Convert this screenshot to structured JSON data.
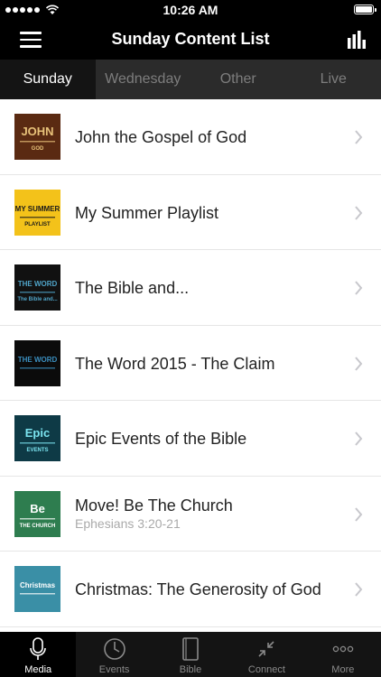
{
  "status_bar": {
    "time": "10:26 AM"
  },
  "header": {
    "title": "Sunday Content List"
  },
  "tabs": [
    {
      "label": "Sunday",
      "active": true
    },
    {
      "label": "Wednesday",
      "active": false
    },
    {
      "label": "Other",
      "active": false
    },
    {
      "label": "Live",
      "active": false
    }
  ],
  "items": [
    {
      "title": "John the Gospel of God",
      "subtitle": "",
      "thumb": {
        "bg": "#5a2a12",
        "accent": "#e8c27a",
        "lines": [
          "JOHN",
          "GOD"
        ]
      }
    },
    {
      "title": "My Summer Playlist",
      "subtitle": "",
      "thumb": {
        "bg": "#f3c21a",
        "accent": "#1a1a1a",
        "lines": [
          "MY SUMMER",
          "PLAYLIST"
        ]
      }
    },
    {
      "title": "The Bible and...",
      "subtitle": "",
      "thumb": {
        "bg": "#111111",
        "accent": "#4fa3c7",
        "lines": [
          "THE WORD",
          "The Bible and..."
        ]
      }
    },
    {
      "title": "The Word 2015 - The Claim",
      "subtitle": "",
      "thumb": {
        "bg": "#0b0b0b",
        "accent": "#3b8fbf",
        "lines": [
          "THE WORD",
          ""
        ]
      }
    },
    {
      "title": "Epic Events of the Bible",
      "subtitle": "",
      "thumb": {
        "bg": "#0e3a46",
        "accent": "#7be3ef",
        "lines": [
          "Epic",
          "EVENTS"
        ]
      }
    },
    {
      "title": "Move! Be The Church",
      "subtitle": "Ephesians 3:20-21",
      "thumb": {
        "bg": "#2e7d4f",
        "accent": "#ffffff",
        "lines": [
          "Be",
          "THE CHURCH"
        ]
      }
    },
    {
      "title": "Christmas: The Generosity of God",
      "subtitle": "",
      "thumb": {
        "bg": "#3a8fa6",
        "accent": "#ffffff",
        "lines": [
          "Christmas",
          ""
        ]
      }
    }
  ],
  "tabbar": [
    {
      "label": "Media",
      "icon": "microphone-icon",
      "active": true
    },
    {
      "label": "Events",
      "icon": "clock-icon",
      "active": false
    },
    {
      "label": "Bible",
      "icon": "book-icon",
      "active": false
    },
    {
      "label": "Connect",
      "icon": "connect-arrows-icon",
      "active": false
    },
    {
      "label": "More",
      "icon": "more-dots-icon",
      "active": false
    }
  ]
}
